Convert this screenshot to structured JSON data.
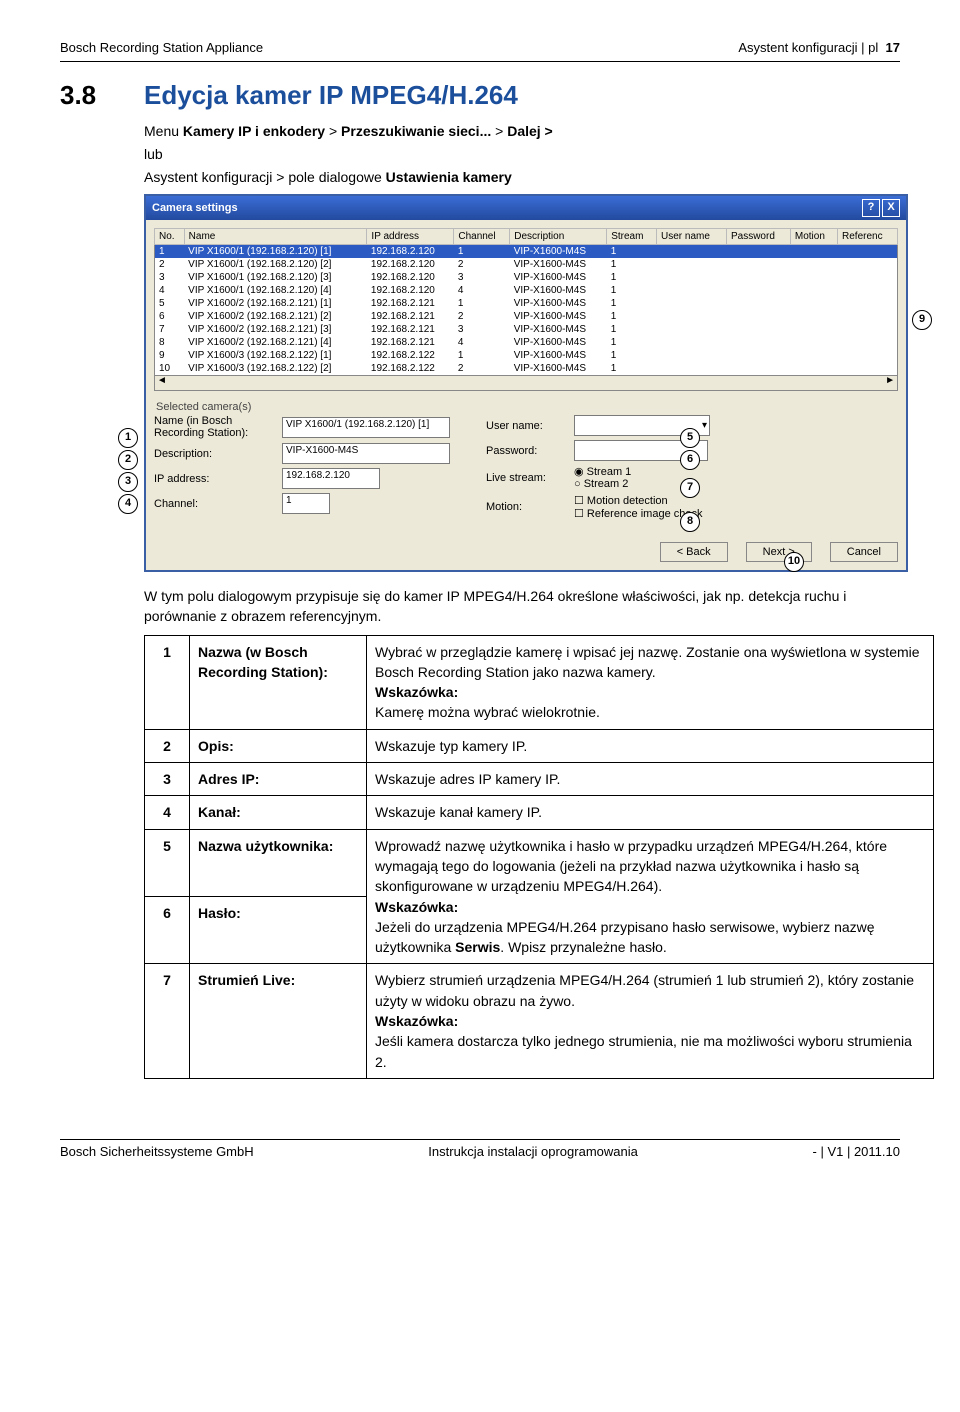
{
  "header": {
    "left": "Bosch Recording Station Appliance",
    "right": "Asystent konfiguracji | pl",
    "pagenum": "17"
  },
  "section": {
    "num": "3.8",
    "title": "Edycja kamer IP MPEG4/H.264",
    "path1_a": "Menu ",
    "path1_b": "Kamery IP i enkodery",
    "path1_c": " > ",
    "path1_d": "Przeszukiwanie sieci...",
    "path1_e": " > ",
    "path1_f": "Dalej >",
    "path2": "lub",
    "path3_a": "Asystent konfiguracji > pole dialogowe ",
    "path3_b": "Ustawienia kamery"
  },
  "dlg": {
    "title": "Camera settings",
    "help": "?",
    "close": "X",
    "cols": [
      "No.",
      "Name",
      "IP address",
      "Channel",
      "Description",
      "Stream",
      "User name",
      "Password",
      "Motion",
      "Referenc"
    ],
    "rows": [
      [
        "1",
        "VIP X1600/1 (192.168.2.120) [1]",
        "192.168.2.120",
        "1",
        "VIP-X1600-M4S",
        "1",
        "",
        "",
        "",
        ""
      ],
      [
        "2",
        "VIP X1600/1 (192.168.2.120) [2]",
        "192.168.2.120",
        "2",
        "VIP-X1600-M4S",
        "1",
        "",
        "",
        "",
        ""
      ],
      [
        "3",
        "VIP X1600/1 (192.168.2.120) [3]",
        "192.168.2.120",
        "3",
        "VIP-X1600-M4S",
        "1",
        "",
        "",
        "",
        ""
      ],
      [
        "4",
        "VIP X1600/1 (192.168.2.120) [4]",
        "192.168.2.120",
        "4",
        "VIP-X1600-M4S",
        "1",
        "",
        "",
        "",
        ""
      ],
      [
        "5",
        "VIP X1600/2 (192.168.2.121) [1]",
        "192.168.2.121",
        "1",
        "VIP-X1600-M4S",
        "1",
        "",
        "",
        "",
        ""
      ],
      [
        "6",
        "VIP X1600/2 (192.168.2.121) [2]",
        "192.168.2.121",
        "2",
        "VIP-X1600-M4S",
        "1",
        "",
        "",
        "",
        ""
      ],
      [
        "7",
        "VIP X1600/2 (192.168.2.121) [3]",
        "192.168.2.121",
        "3",
        "VIP-X1600-M4S",
        "1",
        "",
        "",
        "",
        ""
      ],
      [
        "8",
        "VIP X1600/2 (192.168.2.121) [4]",
        "192.168.2.121",
        "4",
        "VIP-X1600-M4S",
        "1",
        "",
        "",
        "",
        ""
      ],
      [
        "9",
        "VIP X1600/3 (192.168.2.122) [1]",
        "192.168.2.122",
        "1",
        "VIP-X1600-M4S",
        "1",
        "",
        "",
        "",
        ""
      ],
      [
        "10",
        "VIP X1600/3 (192.168.2.122) [2]",
        "192.168.2.122",
        "2",
        "VIP-X1600-M4S",
        "1",
        "",
        "",
        "",
        ""
      ]
    ],
    "selhdr": "Selected camera(s)",
    "l_name": "Name (in Bosch Recording Station):",
    "v_name": "VIP X1600/1 (192.168.2.120) [1]",
    "l_desc": "Description:",
    "v_desc": "VIP-X1600-M4S",
    "l_ip": "IP address:",
    "v_ip": "192.168.2.120",
    "l_ch": "Channel:",
    "v_ch": "1",
    "l_user": "User name:",
    "l_pass": "Password:",
    "l_live": "Live stream:",
    "r1": "Stream 1",
    "r2": "Stream 2",
    "l_motion": "Motion:",
    "chk1": "Motion detection",
    "chk2": "Reference image check",
    "b_back": "< Back",
    "b_next": "Next >",
    "b_cancel": "Cancel"
  },
  "callouts": {
    "c1": "1",
    "c2": "2",
    "c3": "3",
    "c4": "4",
    "c5": "5",
    "c6": "6",
    "c7": "7",
    "c8": "8",
    "c9": "9",
    "c10": "10"
  },
  "after": "W tym polu dialogowym przypisuje się do kamer IP MPEG4/H.264 określone właściwości, jak np. detekcja ruchu i porównanie z obrazem referencyjnym.",
  "desc": [
    {
      "n": "1",
      "l": "Nazwa (w Bosch Recording Station):",
      "t": "Wybrać w przeglądzie kamerę i wpisać jej nazwę. Zostanie ona wyświetlona w systemie Bosch Recording Station jako nazwa kamery.\nWskazówka:\nKamerę można wybrać wielokrotnie."
    },
    {
      "n": "2",
      "l": "Opis:",
      "t": "Wskazuje typ kamery IP."
    },
    {
      "n": "3",
      "l": "Adres IP:",
      "t": "Wskazuje adres IP kamery IP."
    },
    {
      "n": "4",
      "l": "Kanał:",
      "t": "Wskazuje kanał kamery IP."
    },
    {
      "n": "5",
      "l": "Nazwa użytkownika:",
      "t": "",
      "merge": "start"
    },
    {
      "n": "6",
      "l": "Hasło:",
      "t": "Wprowadź nazwę użytkownika i hasło w przypadku urządzeń MPEG4/H.264, które wymagają tego do logowania (jeżeli na przykład nazwa użytkownika i hasło są skonfigurowane w urządzeniu MPEG4/H.264).\nWskazówka:\nJeżeli do urządzenia MPEG4/H.264 przypisano hasło serwisowe, wybierz nazwę użytkownika Serwis. Wpisz przynależne hasło.",
      "merge": "end",
      "serwis": "Serwis"
    },
    {
      "n": "7",
      "l": "Strumień Live:",
      "t": "Wybierz strumień urządzenia MPEG4/H.264 (strumień 1 lub strumień 2), który zostanie użyty w widoku obrazu na żywo.\nWskazówka:\nJeśli kamera dostarcza tylko jednego strumienia, nie ma możliwości wyboru strumienia 2."
    }
  ],
  "footer": {
    "left": "Bosch Sicherheitssysteme GmbH",
    "mid": "Instrukcja instalacji oprogramowania",
    "right": "- | V1 | 2011.10"
  }
}
